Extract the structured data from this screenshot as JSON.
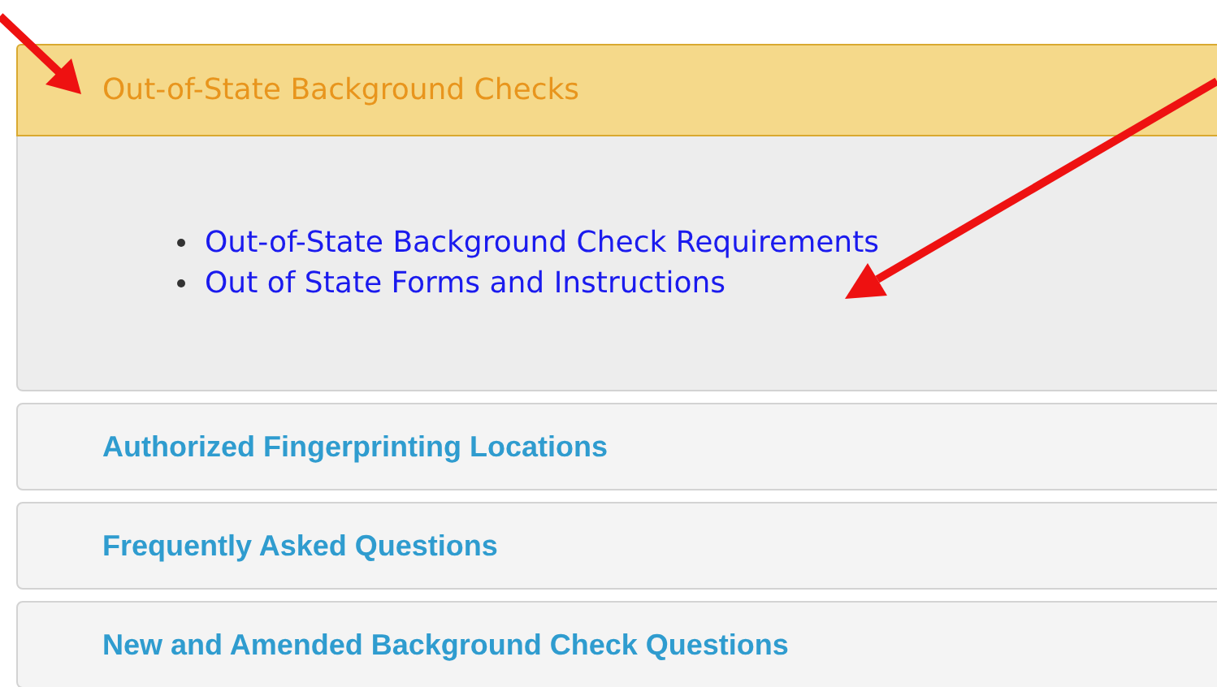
{
  "sections": [
    {
      "title": "Out-of-State Background Checks",
      "expanded": true,
      "links": [
        "Out-of-State Background Check Requirements",
        "Out of State Forms and Instructions"
      ]
    },
    {
      "title": "Authorized Fingerprinting Locations",
      "expanded": false
    },
    {
      "title": "Frequently Asked Questions",
      "expanded": false
    },
    {
      "title": "New and Amended Background Check Questions",
      "expanded": false
    }
  ]
}
